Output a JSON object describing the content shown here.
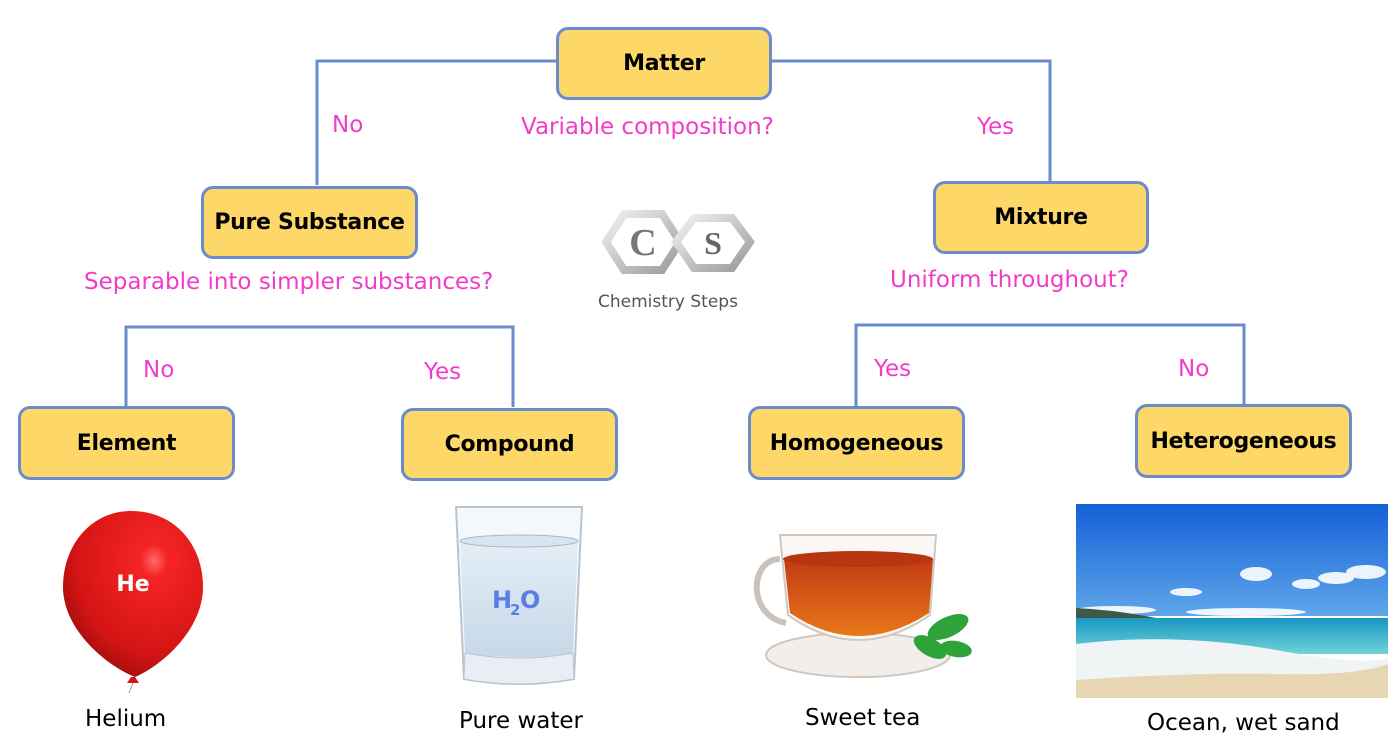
{
  "nodes": {
    "matter": "Matter",
    "pure_substance": "Pure Substance",
    "mixture": "Mixture",
    "element": "Element",
    "compound": "Compound",
    "homogeneous": "Homogeneous",
    "heterogeneous": "Heterogeneous"
  },
  "questions": {
    "variable_composition": "Variable composition?",
    "separable": "Separable into simpler substances?",
    "uniform": "Uniform throughout?"
  },
  "edges": {
    "matter_to_pure": "No",
    "matter_to_mixture": "Yes",
    "pure_to_element": "No",
    "pure_to_compound": "Yes",
    "mixture_to_homogeneous": "Yes",
    "mixture_to_heterogeneous": "No"
  },
  "examples": {
    "element": {
      "label": "Helium",
      "symbol": "He"
    },
    "compound": {
      "label": "Pure water",
      "formula_main": "H",
      "formula_sub": "2",
      "formula_end": "O"
    },
    "homogeneous": {
      "label": "Sweet tea"
    },
    "heterogeneous": {
      "label": "Ocean, wet sand"
    }
  },
  "logo": {
    "c": "C",
    "s": "S",
    "text": "Chemistry Steps"
  },
  "colors": {
    "box_fill": "#fdd869",
    "box_border": "#6a8ccc",
    "question_text": "#f03cc8",
    "connector": "#6a8ccc"
  }
}
